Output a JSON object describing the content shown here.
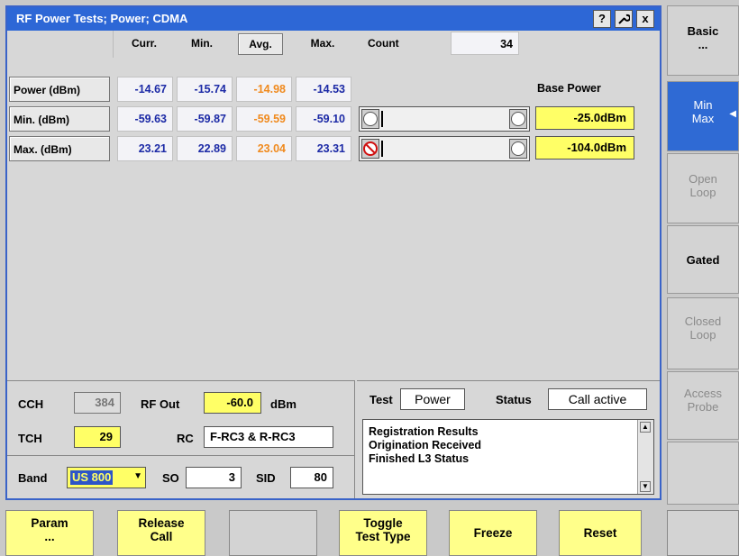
{
  "window": {
    "title": "RF Power Tests; Power; CDMA",
    "help_label": "?",
    "close_label": "x"
  },
  "table": {
    "headers": {
      "curr": "Curr.",
      "min": "Min.",
      "avg": "Avg.",
      "max": "Max.",
      "count": "Count"
    },
    "count_value": "34",
    "base_power_label": "Base Power",
    "rows": [
      {
        "label": "Power (dBm)",
        "curr": "-14.67",
        "min": "-15.74",
        "avg": "-14.98",
        "max": "-14.53"
      },
      {
        "label": "Min.  (dBm)",
        "curr": "-59.63",
        "min": "-59.87",
        "avg": "-59.59",
        "max": "-59.10",
        "base": "-25.0dBm"
      },
      {
        "label": "Max.  (dBm)",
        "curr": "23.21",
        "min": "22.89",
        "avg": "23.04",
        "max": "23.31",
        "base": "-104.0dBm"
      }
    ]
  },
  "params": {
    "cch_label": "CCH",
    "cch_value": "384",
    "rf_out_label": "RF Out",
    "rf_out_value": "-60.0",
    "rf_out_unit": "dBm",
    "tch_label": "TCH",
    "tch_value": "29",
    "rc_label": "RC",
    "rc_value": "F-RC3 & R-RC3",
    "band_label": "Band",
    "band_value": "US 800",
    "so_label": "SO",
    "so_value": "3",
    "sid_label": "SID",
    "sid_value": "80"
  },
  "status": {
    "test_label": "Test",
    "test_value": "Power",
    "status_label": "Status",
    "status_value": "Call active",
    "log": [
      "Registration Results",
      "Origination Received",
      "Finished L3 Status"
    ]
  },
  "right_softkeys": [
    {
      "line1": "Basic",
      "line2": "..."
    },
    {
      "line1": "Min",
      "line2": "Max"
    },
    {
      "line1": "Open",
      "line2": "Loop"
    },
    {
      "line1": "Gated",
      "line2": ""
    },
    {
      "line1": "Closed",
      "line2": "Loop"
    },
    {
      "line1": "Access",
      "line2": "Probe"
    },
    {
      "line1": "",
      "line2": ""
    }
  ],
  "bottom_softkeys": [
    {
      "line1": "Param",
      "line2": "..."
    },
    {
      "line1": "Release",
      "line2": "Call"
    },
    {
      "line1": "",
      "line2": ""
    },
    {
      "line1": "Toggle",
      "line2": "Test Type"
    },
    {
      "line1": "Freeze",
      "line2": ""
    },
    {
      "line1": "Reset",
      "line2": ""
    },
    {
      "line1": "",
      "line2": ""
    }
  ],
  "colors": {
    "title_blue": "#2d67d6",
    "value_blue": "#1c2aa6",
    "avg_orange": "#f08a1e",
    "highlight_yellow": "#ffff66"
  }
}
